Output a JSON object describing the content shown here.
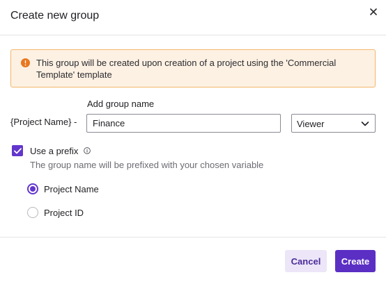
{
  "dialog": {
    "title": "Create new group"
  },
  "alert": {
    "text": "This group will be created upon creation of a project using the 'Commercial Template' template"
  },
  "form": {
    "add_group_label": "Add group name",
    "prefix_variable": "{Project Name} -",
    "group_name_value": "Finance",
    "role_selected": "Viewer",
    "use_prefix_label": "Use a prefix",
    "use_prefix_checked": true,
    "use_prefix_description": "The group name will be prefixed with your chosen variable",
    "prefix_options": [
      {
        "label": "Project Name",
        "selected": true
      },
      {
        "label": "Project ID",
        "selected": false
      }
    ]
  },
  "footer": {
    "cancel_label": "Cancel",
    "create_label": "Create"
  },
  "colors": {
    "accent": "#5b2fc4",
    "alert_background": "#fdf1e3",
    "alert_border": "#f3b56b",
    "alert_icon": "#e8771f"
  },
  "icons": {
    "close": "close-icon",
    "alert": "warning-circle-icon",
    "info": "info-icon",
    "chevron": "chevron-down-icon",
    "check": "checkmark-icon"
  }
}
